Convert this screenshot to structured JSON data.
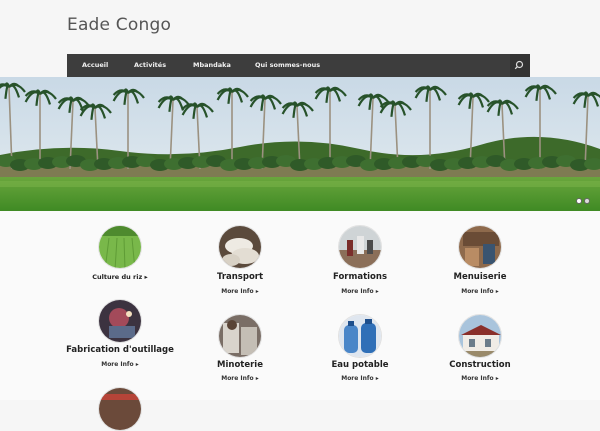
{
  "site": {
    "title": "Eade Congo"
  },
  "nav": {
    "items": [
      "Accueil",
      "Activités",
      "Mbandaka",
      "Qui sommes-nous"
    ],
    "search_icon": "search-icon"
  },
  "hero": {
    "slides": 2,
    "active_slide": 0
  },
  "features": [
    {
      "title": "Culture du riz ▸",
      "more": "",
      "icon": "rice-field-photo"
    },
    {
      "title": "Transport",
      "more": "More Info ▸",
      "icon": "sacks-photo"
    },
    {
      "title": "Formations",
      "more": "More Info ▸",
      "icon": "training-photo"
    },
    {
      "title": "Menuiserie",
      "more": "More Info ▸",
      "icon": "carpentry-photo"
    },
    {
      "title": "Fabrication d'outillage",
      "more": "More Info ▸",
      "icon": "toolmaking-photo"
    },
    {
      "title": "Minoterie",
      "more": "More Info ▸",
      "icon": "mill-photo"
    },
    {
      "title": "Eau potable",
      "more": "More Info ▸",
      "icon": "water-bottles-photo"
    },
    {
      "title": "Construction",
      "more": "More Info ▸",
      "icon": "building-photo"
    }
  ],
  "colors": {
    "nav_bg": "#3d3d3d",
    "page_bg": "#f6f6f6",
    "title_text": "#555555"
  }
}
